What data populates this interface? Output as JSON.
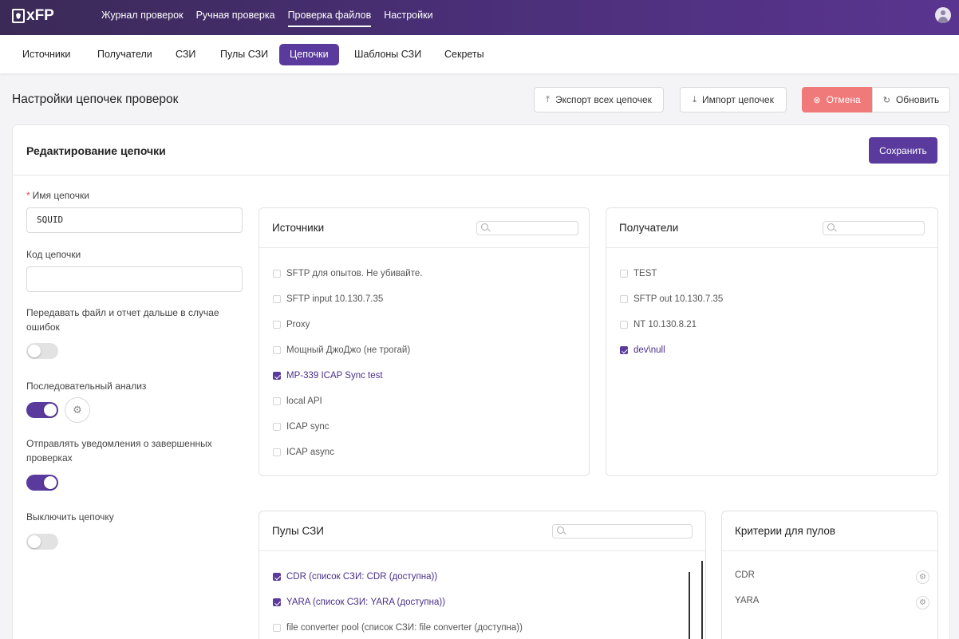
{
  "app": {
    "logo_text": "xFP"
  },
  "topnav": {
    "items": [
      {
        "label": "Журнал проверок"
      },
      {
        "label": "Ручная проверка"
      },
      {
        "label": "Проверка файлов",
        "active": true
      },
      {
        "label": "Настройки"
      }
    ]
  },
  "subnav": {
    "tabs": [
      {
        "label": "Источники"
      },
      {
        "label": "Получатели"
      },
      {
        "label": "СЗИ"
      },
      {
        "label": "Пулы СЗИ"
      },
      {
        "label": "Цепочки",
        "active": true
      },
      {
        "label": "Шаблоны СЗИ"
      },
      {
        "label": "Секреты"
      }
    ]
  },
  "header": {
    "title": "Настройки цепочек проверок",
    "export_label": "Экспорт всех цепочек",
    "import_label": "Импорт цепочек",
    "cancel_label": "Отмена",
    "refresh_label": "Обновить"
  },
  "editor": {
    "title": "Редактирование цепочки",
    "save_label": "Сохранить",
    "name_label": "Имя цепочки",
    "name_value": "SQUID",
    "code_label": "Код цепочки",
    "code_value": "",
    "pass_on_error_label": "Передавать файл и отчет дальше в случае ошибок",
    "pass_on_error": false,
    "sequential_label": "Последовательный анализ",
    "sequential": true,
    "notify_label": "Отправлять уведомления о завершенных проверках",
    "notify": true,
    "disable_label": "Выключить цепочку",
    "disable": false
  },
  "sources": {
    "title": "Источники",
    "search_placeholder": "",
    "items": [
      {
        "label": "SFTP для опытов. Не убивайте.",
        "checked": false
      },
      {
        "label": "SFTP input 10.130.7.35",
        "checked": false
      },
      {
        "label": "Proxy",
        "checked": false
      },
      {
        "label": "Мощный ДжоДжо (не трогай)",
        "checked": false
      },
      {
        "label": "MP-339 ICAP Sync test",
        "checked": true
      },
      {
        "label": "local API",
        "checked": false
      },
      {
        "label": "ICAP sync",
        "checked": false
      },
      {
        "label": "ICAP async",
        "checked": false
      }
    ]
  },
  "receivers": {
    "title": "Получатели",
    "search_placeholder": "",
    "items": [
      {
        "label": "TEST",
        "checked": false
      },
      {
        "label": "SFTP out 10.130.7.35",
        "checked": false
      },
      {
        "label": "NT 10.130.8.21",
        "checked": false
      },
      {
        "label": "dev\\null",
        "checked": true
      }
    ]
  },
  "pools": {
    "title": "Пулы СЗИ",
    "search_placeholder": "",
    "items": [
      {
        "label": "CDR (список СЗИ: CDR (доступна))",
        "checked": true
      },
      {
        "label": "YARA (список СЗИ: YARA (доступна))",
        "checked": true
      },
      {
        "label": "file converter pool (список СЗИ: file converter (доступна))",
        "checked": false
      }
    ]
  },
  "criteria": {
    "title": "Критерии для пулов",
    "items": [
      {
        "label": "CDR"
      },
      {
        "label": "YARA"
      }
    ]
  },
  "colors": {
    "accent": "#5a3a9c",
    "danger": "#f07a7a"
  }
}
